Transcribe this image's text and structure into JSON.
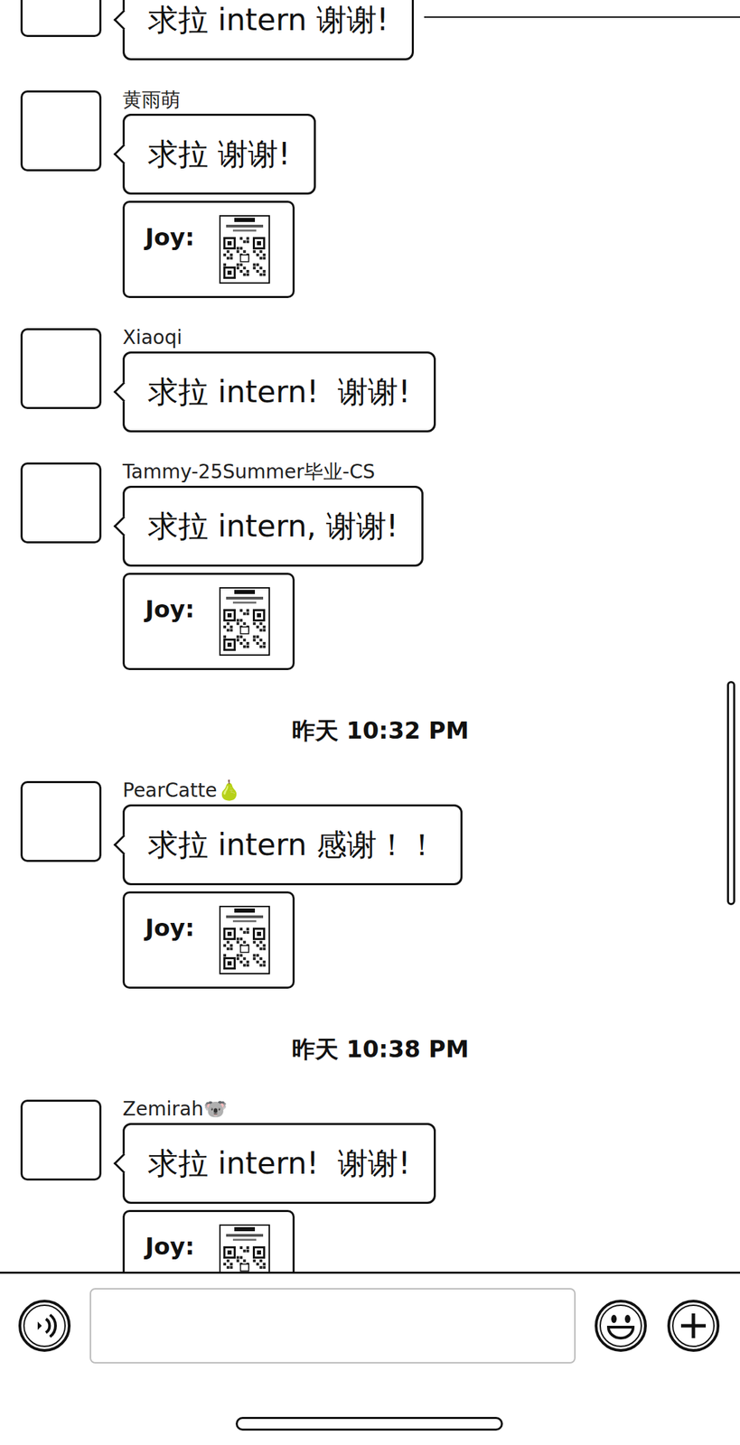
{
  "chat": {
    "items": [
      {
        "kind": "message",
        "sender": "",
        "text": "求拉 intern 谢谢!",
        "card": null
      },
      {
        "kind": "message",
        "sender": "黄雨萌",
        "text": "求拉 谢谢!",
        "card": {
          "sender": "Joy:"
        }
      },
      {
        "kind": "message",
        "sender": "Xiaoqi",
        "text": "求拉 intern!  谢谢!",
        "card": null
      },
      {
        "kind": "message",
        "sender": "Tammy-25Summer毕业-CS",
        "text": "求拉 intern, 谢谢!",
        "card": {
          "sender": "Joy:"
        }
      },
      {
        "kind": "time",
        "text": "昨天 10:32 PM"
      },
      {
        "kind": "message",
        "sender": "PearCatte🍐",
        "text": "求拉 intern 感谢！！",
        "card": {
          "sender": "Joy:"
        }
      },
      {
        "kind": "time",
        "text": "昨天 10:38 PM"
      },
      {
        "kind": "message",
        "sender": "Zemirah🐨",
        "text": "求拉 intern!  谢谢!",
        "card": {
          "sender": "Joy:"
        }
      }
    ]
  },
  "scrollbar": {
    "level": 0.65
  },
  "composer": {
    "text": ""
  }
}
